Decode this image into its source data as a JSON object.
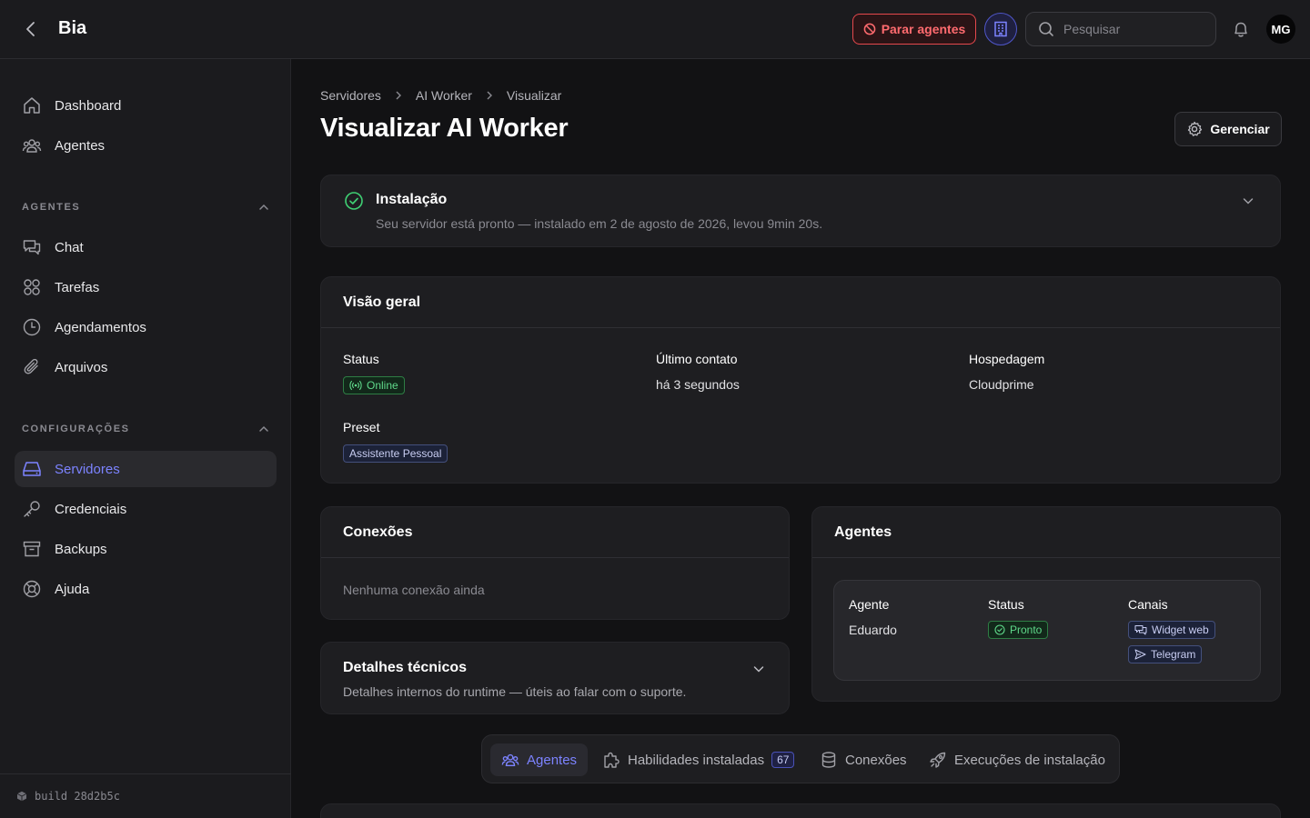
{
  "app": {
    "title": "Bia"
  },
  "header": {
    "stop_agents_label": "Parar agentes",
    "search_placeholder": "Pesquisar",
    "avatar_initials": "MG"
  },
  "sidebar": {
    "top_items": [
      {
        "label": "Dashboard",
        "icon": "home-icon"
      },
      {
        "label": "Agentes",
        "icon": "users-icon"
      }
    ],
    "sections": [
      {
        "title": "AGENTES",
        "items": [
          {
            "label": "Chat",
            "icon": "chat-icon"
          },
          {
            "label": "Tarefas",
            "icon": "grid-icon"
          },
          {
            "label": "Agendamentos",
            "icon": "clock-icon"
          },
          {
            "label": "Arquivos",
            "icon": "paperclip-icon"
          }
        ]
      },
      {
        "title": "CONFIGURAÇÕES",
        "items": [
          {
            "label": "Servidores",
            "icon": "server-icon",
            "active": true
          },
          {
            "label": "Credenciais",
            "icon": "key-icon"
          },
          {
            "label": "Backups",
            "icon": "archive-icon"
          },
          {
            "label": "Ajuda",
            "icon": "lifebuoy-icon"
          }
        ]
      }
    ],
    "build": "build 28d2b5c"
  },
  "breadcrumb": [
    "Servidores",
    "AI Worker",
    "Visualizar"
  ],
  "page": {
    "title": "Visualizar AI Worker",
    "manage_label": "Gerenciar"
  },
  "installation": {
    "title": "Instalação",
    "subtitle": "Seu servidor está pronto — instalado em 2 de agosto de 2026, levou 9min 20s."
  },
  "overview": {
    "title": "Visão geral",
    "status_label": "Status",
    "status_value": "Online",
    "last_contact_label": "Último contato",
    "last_contact_value": "há 3 segundos",
    "hosting_label": "Hospedagem",
    "hosting_value": "Cloudprime",
    "preset_label": "Preset",
    "preset_value": "Assistente Pessoal"
  },
  "connections": {
    "title": "Conexões",
    "empty": "Nenhuma conexão ainda"
  },
  "tech_details": {
    "title": "Detalhes técnicos",
    "subtitle": "Detalhes internos do runtime — úteis ao falar com o suporte."
  },
  "agents_card": {
    "title": "Agentes",
    "headers": [
      "Agente",
      "Status",
      "Canais"
    ],
    "rows": [
      {
        "agent": "Eduardo",
        "status": "Pronto",
        "channels": [
          "Widget web",
          "Telegram"
        ]
      }
    ]
  },
  "tabs": [
    {
      "label": "Agentes",
      "active": true
    },
    {
      "label": "Habilidades instaladas",
      "count": "67"
    },
    {
      "label": "Conexões"
    },
    {
      "label": "Execuções de instalação"
    }
  ],
  "colors": {
    "accent": "#7c83ff",
    "danger": "#e5484d",
    "success": "#5fd88a",
    "background": "#121214",
    "surface": "#1e1e21"
  }
}
